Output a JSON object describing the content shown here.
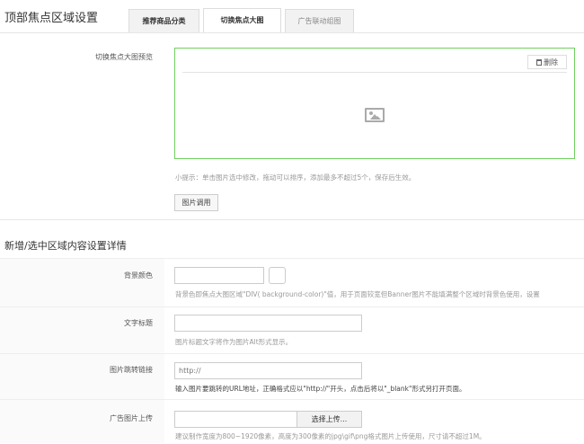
{
  "header": {
    "title": "顶部焦点区域设置"
  },
  "tabs": [
    {
      "label": "推荐商品分类"
    },
    {
      "label": "切换焦点大图"
    },
    {
      "label": "广告联动组图"
    }
  ],
  "preview": {
    "label": "切换焦点大图预览",
    "delete_label": "删除",
    "tip": "小提示：单击图片选中修改，拖动可以排序，添加最多不超过5个，保存后生效。",
    "call_button": "图片调用"
  },
  "detail": {
    "title": "新增/选中区域内容设置详情",
    "bg_color": {
      "label": "背景颜色",
      "value": "",
      "hint": "背景色即焦点大图区域\"DIV( background-color)\"值，用于页面较宽但Banner图片不能填满整个区域时背景色使用，设置"
    },
    "alt_title": {
      "label": "文字标题",
      "value": "",
      "hint": "图片标题文字将作为图片Alt形式显示。"
    },
    "link": {
      "label": "图片跳转链接",
      "value": "http://",
      "hint": "输入图片要跳转的URL地址，正确格式应以\"http://\"开头，点击后将以\"_blank\"形式另打开页面。"
    },
    "upload": {
      "label": "广告图片上传",
      "value": "",
      "button": "选择上传...",
      "hint": "建议制作宽度为800~1920像素，高度为300像素的jpg\\gif\\png格式图片上传使用，尺寸请不超过1M。"
    }
  }
}
